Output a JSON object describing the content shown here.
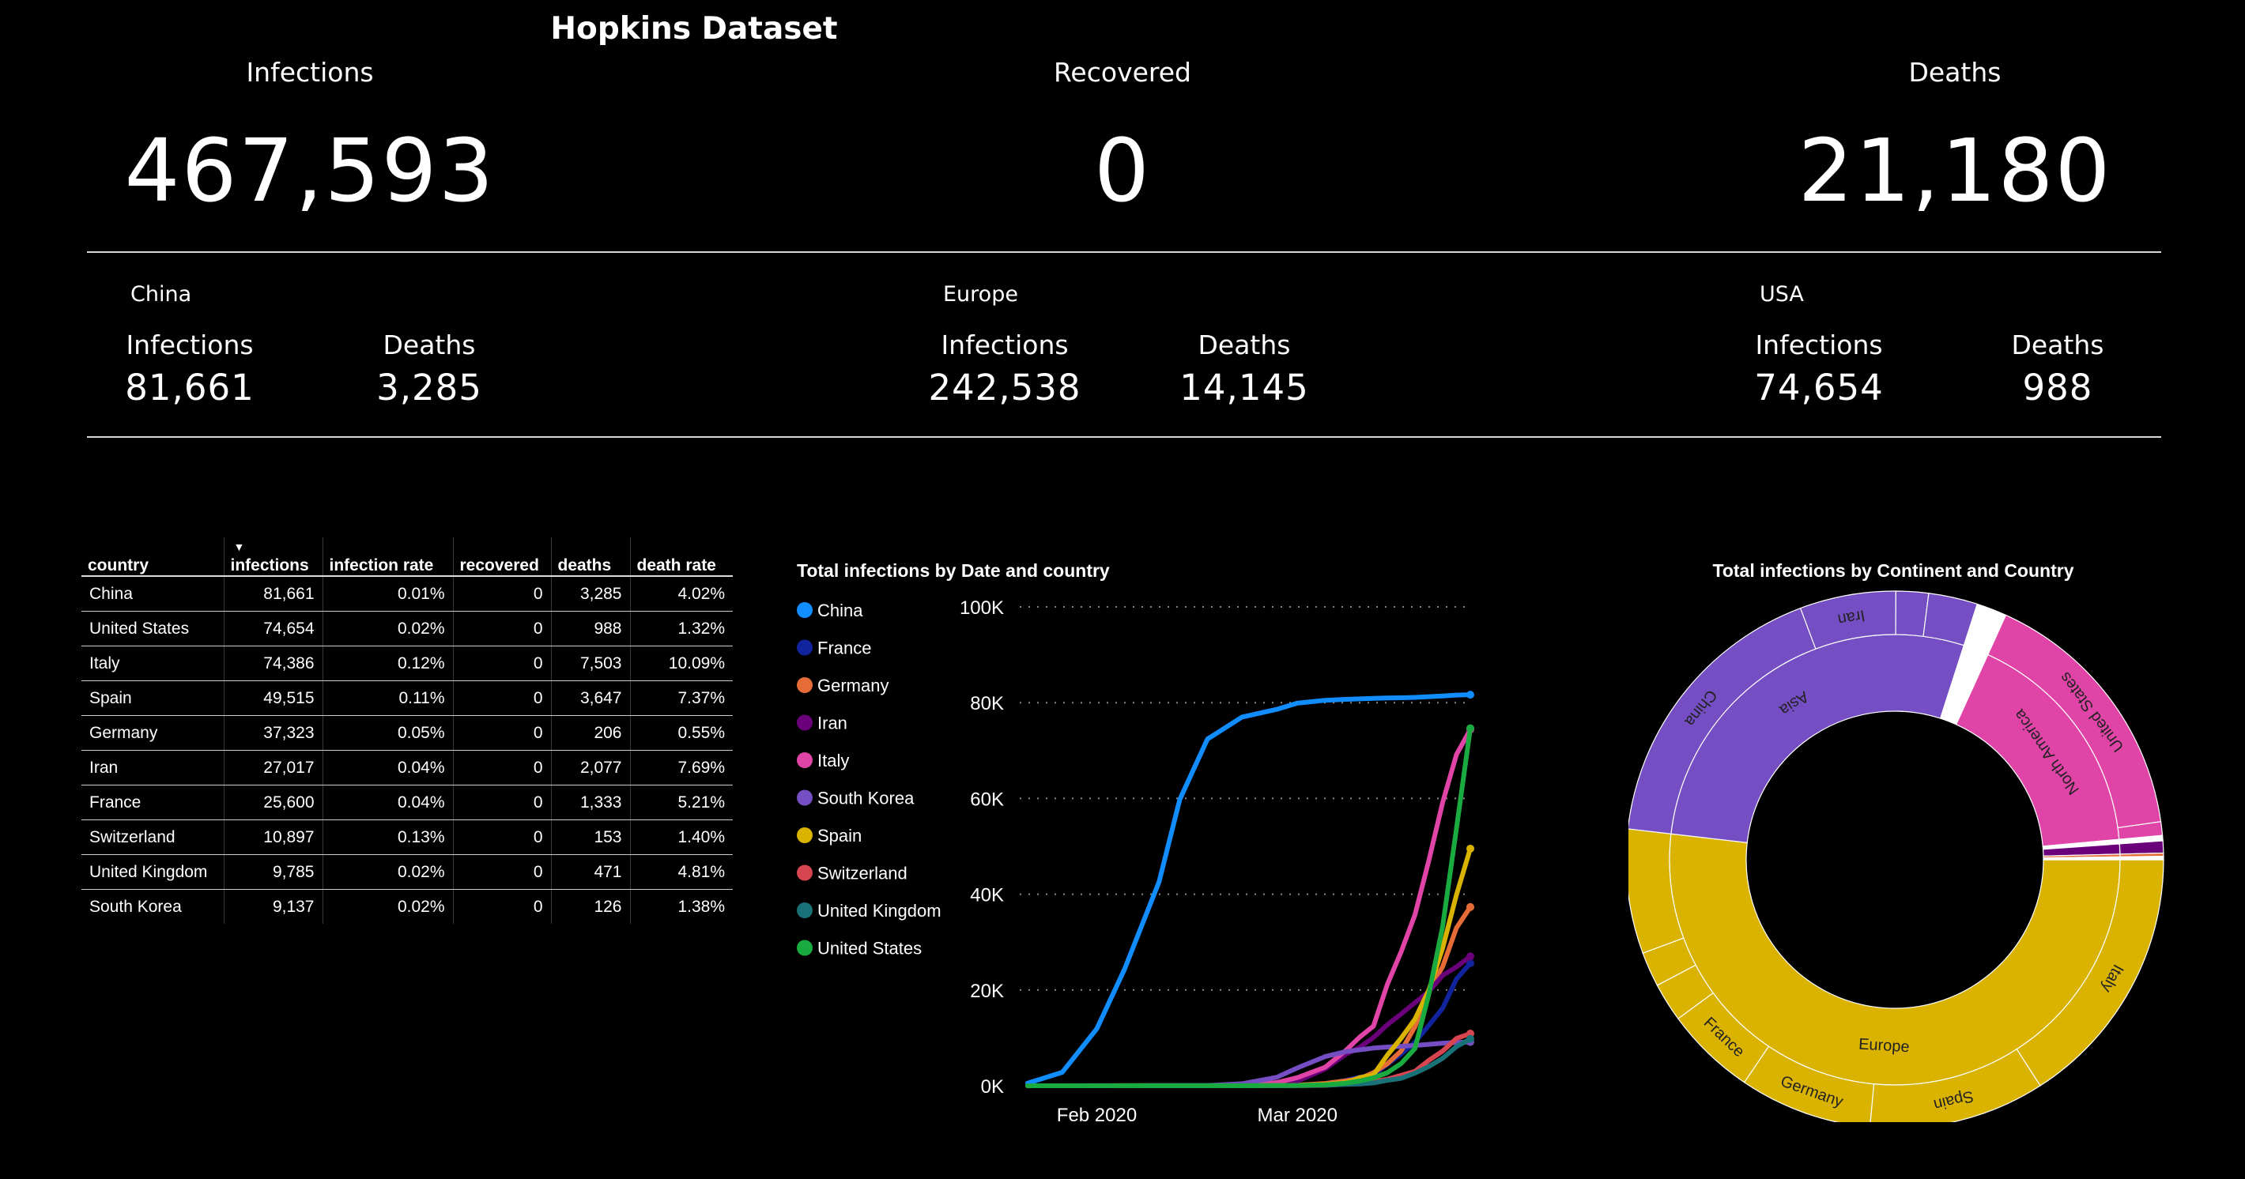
{
  "header": {
    "title": "Hopkins Dataset"
  },
  "kpis": [
    {
      "label": "Infections",
      "value": "467,593"
    },
    {
      "label": "Recovered",
      "value": "0"
    },
    {
      "label": "Deaths",
      "value": "21,180"
    }
  ],
  "regions": [
    {
      "name": "China",
      "infections_label": "Infections",
      "infections": "81,661",
      "deaths_label": "Deaths",
      "deaths": "3,285"
    },
    {
      "name": "Europe",
      "infections_label": "Infections",
      "infections": "242,538",
      "deaths_label": "Deaths",
      "deaths": "14,145"
    },
    {
      "name": "USA",
      "infections_label": "Infections",
      "infections": "74,654",
      "deaths_label": "Deaths",
      "deaths": "988"
    }
  ],
  "table": {
    "columns": [
      "country",
      "infections",
      "infection rate",
      "recovered",
      "deaths",
      "death rate"
    ],
    "sort_column": "infections",
    "rows": [
      [
        "China",
        "81,661",
        "0.01%",
        "0",
        "3,285",
        "4.02%"
      ],
      [
        "United States",
        "74,654",
        "0.02%",
        "0",
        "988",
        "1.32%"
      ],
      [
        "Italy",
        "74,386",
        "0.12%",
        "0",
        "7,503",
        "10.09%"
      ],
      [
        "Spain",
        "49,515",
        "0.11%",
        "0",
        "3,647",
        "7.37%"
      ],
      [
        "Germany",
        "37,323",
        "0.05%",
        "0",
        "206",
        "0.55%"
      ],
      [
        "Iran",
        "27,017",
        "0.04%",
        "0",
        "2,077",
        "7.69%"
      ],
      [
        "France",
        "25,600",
        "0.04%",
        "0",
        "1,333",
        "5.21%"
      ],
      [
        "Switzerland",
        "10,897",
        "0.13%",
        "0",
        "153",
        "1.40%"
      ],
      [
        "United Kingdom",
        "9,785",
        "0.02%",
        "0",
        "471",
        "4.81%"
      ],
      [
        "South Korea",
        "9,137",
        "0.02%",
        "0",
        "126",
        "1.38%"
      ]
    ]
  },
  "chart_data": [
    {
      "type": "line",
      "title": "Total infections by Date and country",
      "xlabel": "",
      "ylabel": "",
      "x": [
        "2020-01-22",
        "2020-01-27",
        "2020-02-01",
        "2020-02-05",
        "2020-02-10",
        "2020-02-13",
        "2020-02-17",
        "2020-02-22",
        "2020-02-27",
        "2020-03-01",
        "2020-03-05",
        "2020-03-08",
        "2020-03-10",
        "2020-03-12",
        "2020-03-14",
        "2020-03-16",
        "2020-03-18",
        "2020-03-20",
        "2020-03-22",
        "2020-03-24",
        "2020-03-26"
      ],
      "xticks": [
        "Feb 2020",
        "Mar 2020"
      ],
      "xtick_positions": [
        "2020-02-01",
        "2020-03-01"
      ],
      "yticks": [
        "0K",
        "20K",
        "40K",
        "60K",
        "80K",
        "100K"
      ],
      "ylim": [
        0,
        100000
      ],
      "grid": true,
      "legend": "left",
      "series": [
        {
          "name": "China",
          "color": "#118DFF",
          "values": [
            550,
            2800,
            11900,
            24300,
            42600,
            59800,
            72400,
            77000,
            78600,
            79900,
            80500,
            80700,
            80800,
            80900,
            80980,
            81030,
            81100,
            81250,
            81400,
            81590,
            81661
          ]
        },
        {
          "name": "France",
          "color": "#12239E",
          "values": [
            0,
            3,
            6,
            6,
            11,
            11,
            12,
            12,
            38,
            130,
            377,
            1126,
            1784,
            2281,
            4480,
            6650,
            9100,
            12600,
            16200,
            22300,
            25600
          ]
        },
        {
          "name": "Germany",
          "color": "#E66C37",
          "values": [
            0,
            1,
            7,
            12,
            14,
            16,
            16,
            16,
            46,
            130,
            482,
            1040,
            1457,
            2745,
            4585,
            7272,
            12327,
            19848,
            24873,
            32986,
            37323
          ]
        },
        {
          "name": "Iran",
          "color": "#6B007B",
          "values": [
            0,
            0,
            0,
            0,
            0,
            0,
            0,
            28,
            245,
            978,
            3513,
            6566,
            8042,
            10075,
            12729,
            14991,
            17361,
            19644,
            23049,
            24811,
            27017
          ]
        },
        {
          "name": "Italy",
          "color": "#E044A7",
          "values": [
            0,
            0,
            2,
            2,
            3,
            3,
            3,
            62,
            655,
            1694,
            3858,
            7375,
            10149,
            12462,
            21157,
            27980,
            35713,
            47021,
            59138,
            69176,
            74386
          ]
        },
        {
          "name": "South Korea",
          "color": "#744EC2",
          "values": [
            1,
            4,
            12,
            19,
            27,
            28,
            30,
            433,
            1766,
            3736,
            6088,
            7134,
            7513,
            7869,
            8086,
            8236,
            8413,
            8652,
            8897,
            9037,
            9137
          ]
        },
        {
          "name": "Spain",
          "color": "#D9B300",
          "values": [
            0,
            0,
            1,
            1,
            2,
            2,
            2,
            2,
            32,
            84,
            261,
            673,
            1695,
            2277,
            6391,
            9942,
            13910,
            19980,
            28768,
            39885,
            49515
          ]
        },
        {
          "name": "Switzerland",
          "color": "#D64550",
          "values": [
            0,
            0,
            0,
            0,
            0,
            0,
            0,
            0,
            8,
            27,
            90,
            337,
            491,
            858,
            1359,
            2200,
            3028,
            5294,
            7245,
            9877,
            10897
          ]
        },
        {
          "name": "United Kingdom",
          "color": "#197278",
          "values": [
            0,
            0,
            2,
            2,
            8,
            9,
            9,
            9,
            15,
            36,
            116,
            273,
            384,
            590,
            1140,
            1551,
            2642,
            4014,
            5741,
            8164,
            9785
          ]
        },
        {
          "name": "United States",
          "color": "#1AAB40",
          "values": [
            1,
            5,
            8,
            12,
            12,
            13,
            13,
            15,
            60,
            74,
            217,
            537,
            994,
            1663,
            2727,
            4632,
            7783,
            19100,
            33276,
            53740,
            74654
          ]
        }
      ]
    },
    {
      "type": "pie",
      "subtype": "sunburst",
      "title": "Total infections by Continent and Country",
      "inner": [
        {
          "name": "Europe",
          "color": "#D9B300",
          "value": 242538
        },
        {
          "name": "Asia",
          "color": "#744EC2",
          "value": 131600
        },
        {
          "name": "",
          "color": "#ffffff",
          "value": 8500
        },
        {
          "name": "North America",
          "color": "#E044A7",
          "value": 78500
        },
        {
          "name": "",
          "color": "#ffffff",
          "value": 1500
        },
        {
          "name": "",
          "color": "#6B007B",
          "value": 3400
        },
        {
          "name": "",
          "color": "#E66C37",
          "value": 900
        },
        {
          "name": "",
          "color": "#ffffff",
          "value": 955
        }
      ],
      "outer": [
        {
          "name": "Italy",
          "color": "#D9B300",
          "value": 74386
        },
        {
          "name": "Spain",
          "color": "#D9B300",
          "value": 49515
        },
        {
          "name": "Germany",
          "color": "#D9B300",
          "value": 37323
        },
        {
          "name": "France",
          "color": "#D9B300",
          "value": 25600
        },
        {
          "name": "",
          "color": "#D9B300",
          "value": 10897
        },
        {
          "name": "",
          "color": "#D9B300",
          "value": 9785
        },
        {
          "name": "",
          "color": "#D9B300",
          "value": 35032
        },
        {
          "name": "China",
          "color": "#744EC2",
          "value": 81661
        },
        {
          "name": "Iran",
          "color": "#744EC2",
          "value": 27017
        },
        {
          "name": "",
          "color": "#744EC2",
          "value": 9137
        },
        {
          "name": "",
          "color": "#744EC2",
          "value": 13785
        },
        {
          "name": "",
          "color": "#ffffff",
          "value": 8500
        },
        {
          "name": "United States",
          "color": "#E044A7",
          "value": 74654
        },
        {
          "name": "",
          "color": "#E044A7",
          "value": 3846
        },
        {
          "name": "",
          "color": "#ffffff",
          "value": 1500
        },
        {
          "name": "",
          "color": "#6B007B",
          "value": 3400
        },
        {
          "name": "",
          "color": "#E66C37",
          "value": 900
        },
        {
          "name": "",
          "color": "#ffffff",
          "value": 955
        }
      ]
    }
  ]
}
